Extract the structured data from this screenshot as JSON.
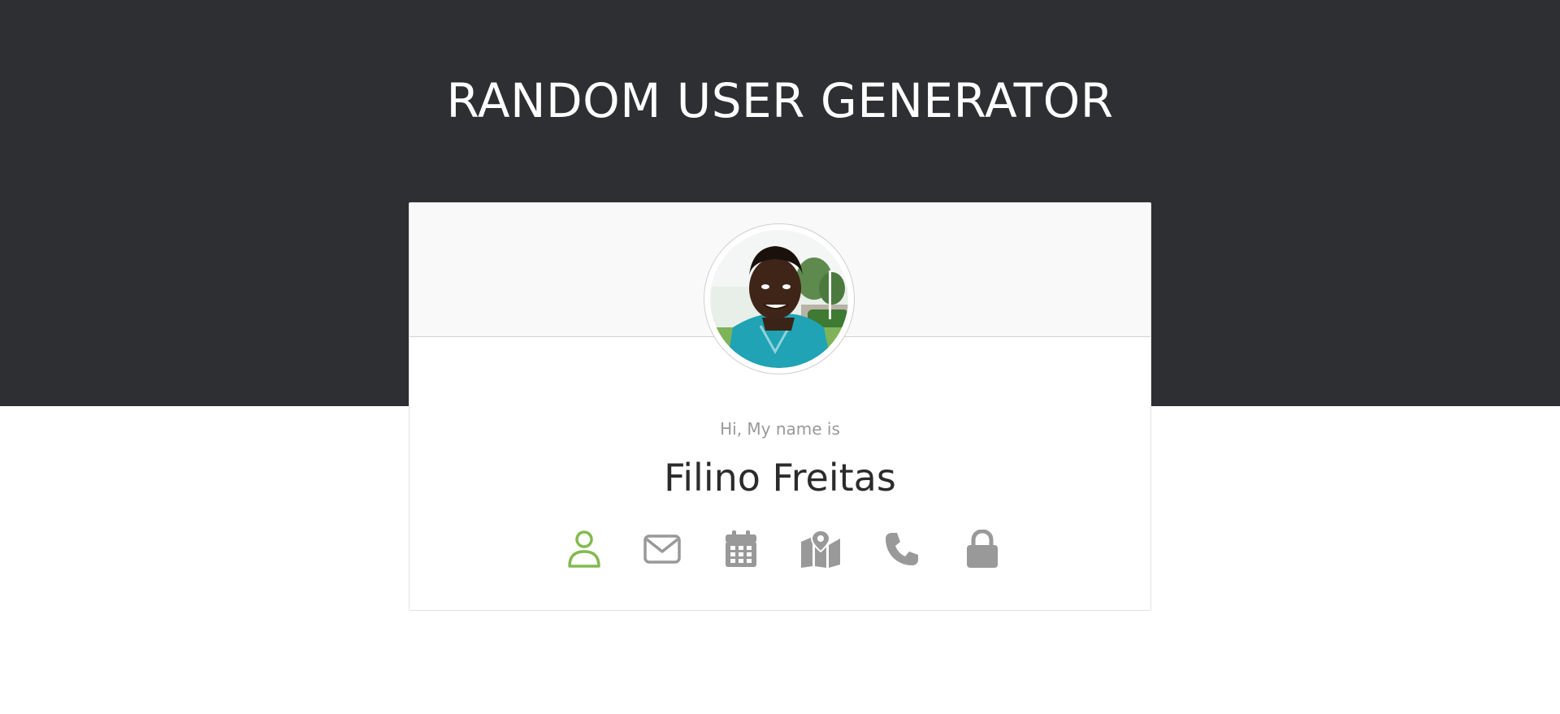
{
  "header": {
    "title": "RANDOM USER GENERATOR"
  },
  "user": {
    "label": "Hi, My name is",
    "value": "Filino Freitas"
  },
  "icons": [
    {
      "name": "person-icon",
      "active": true
    },
    {
      "name": "envelope-icon",
      "active": false
    },
    {
      "name": "calendar-icon",
      "active": false
    },
    {
      "name": "map-icon",
      "active": false
    },
    {
      "name": "phone-icon",
      "active": false
    },
    {
      "name": "lock-icon",
      "active": false
    }
  ],
  "colors": {
    "header_bg": "#2e2f33",
    "active_icon": "#83ba4f",
    "inactive_icon": "#999999"
  }
}
